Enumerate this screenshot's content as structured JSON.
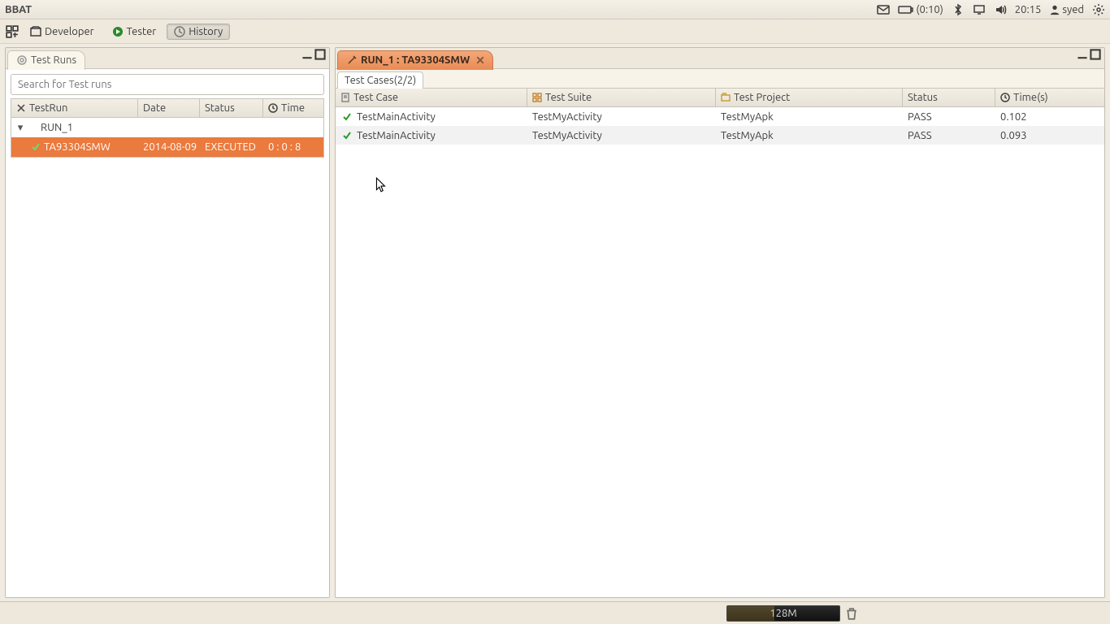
{
  "menubar": {
    "title": "BBAT"
  },
  "indicators": {
    "battery": "(0:10)",
    "clock": "20:15",
    "user": "syed"
  },
  "perspectives": {
    "developer": "Developer",
    "tester": "Tester",
    "history": "History"
  },
  "left_panel": {
    "title": "Test Runs",
    "search_placeholder": "Search for Test runs",
    "columns": {
      "run": "TestRun",
      "date": "Date",
      "status": "Status",
      "time": "Time"
    },
    "rows": {
      "parent": {
        "name": "RUN_1"
      },
      "child": {
        "name": "TA93304SMW",
        "date": "2014-08-09",
        "status": "EXECUTED",
        "time": "0 : 0 : 8"
      }
    }
  },
  "right_panel": {
    "tab_title": "RUN_1 : TA93304SMW",
    "subtab": "Test Cases(2/2)",
    "columns": {
      "case": "Test Case",
      "suite": "Test Suite",
      "project": "Test Project",
      "status": "Status",
      "time": "Time(s)"
    },
    "rows": [
      {
        "case": "TestMainActivity",
        "suite": "TestMyActivity",
        "project": "TestMyApk",
        "status": "PASS",
        "time": "0.102"
      },
      {
        "case": "TestMainActivity",
        "suite": "TestMyActivity",
        "project": "TestMyApk",
        "status": "PASS",
        "time": "0.093"
      }
    ]
  },
  "statusbar": {
    "heap": "128M"
  }
}
